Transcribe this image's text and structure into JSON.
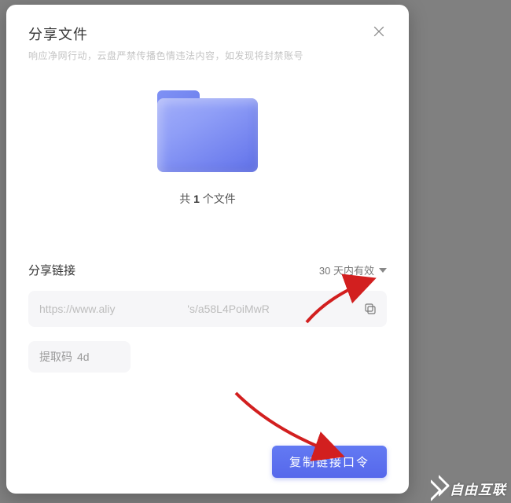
{
  "modal": {
    "title": "分享文件",
    "subtitle": "响应净网行动，云盘严禁传播色情违法内容，如发现将封禁账号",
    "file_count_prefix": "共 ",
    "file_count_num": "1",
    "file_count_suffix": " 个文件",
    "share_link_label": "分享链接",
    "expiry_label": "30 天内有效",
    "share_url_left": "https://www.aliy",
    "share_url_right": "'s/a58L4PoiMwR",
    "code_label": "提取码",
    "code_value": "4d",
    "copy_button_label": "复制链接口令"
  },
  "watermark": {
    "text": "自由互联"
  },
  "colors": {
    "primary": "#5b6ff0",
    "folder_start": "#a2aef9",
    "folder_end": "#5f70e7",
    "annotation": "#d21f1f"
  }
}
